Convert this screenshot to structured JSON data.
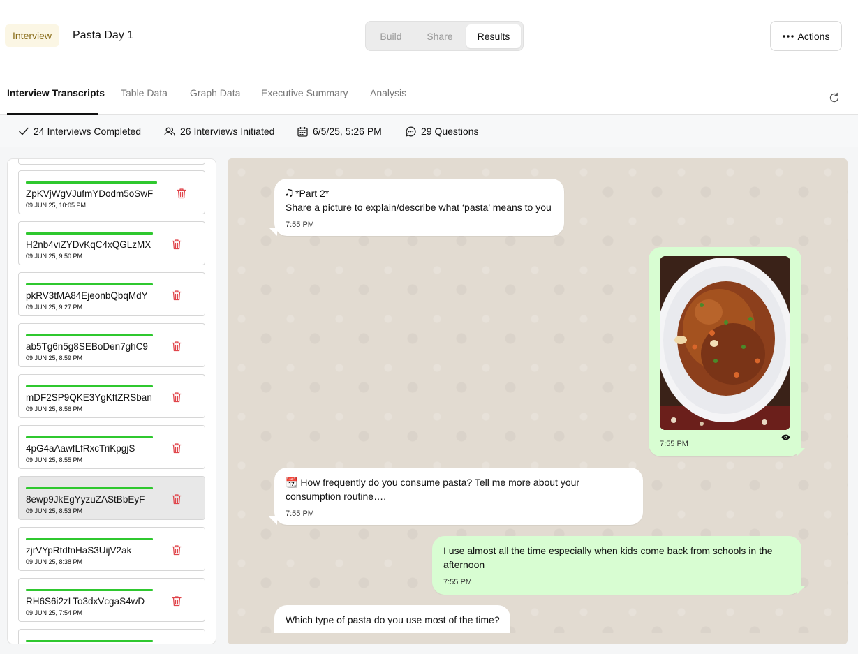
{
  "header": {
    "type_badge": "Interview",
    "title": "Pasta Day 1",
    "segments": [
      "Build",
      "Share",
      "Results"
    ],
    "active_segment": "Results",
    "actions_label": "Actions"
  },
  "tabs": {
    "items": [
      "Interview Transcripts",
      "Table Data",
      "Graph Data",
      "Executive Summary",
      "Analysis"
    ],
    "active": "Interview Transcripts"
  },
  "stats": {
    "completed": "24 Interviews Completed",
    "initiated": "26 Interviews Initiated",
    "date": "6/5/25, 5:26 PM",
    "questions": "29 Questions"
  },
  "interviews": [
    {
      "id": "ZpKVjWgVJufmYDodm5oSwF",
      "date": "09 JUN 25, 10:05 PM"
    },
    {
      "id": "H2nb4viZYDvKqC4xQGLzMX",
      "date": "09 JUN 25, 9:50 PM"
    },
    {
      "id": "pkRV3tMA84EjeonbQbqMdY",
      "date": "09 JUN 25, 9:27 PM"
    },
    {
      "id": "ab5Tg6n5g8SEBoDen7ghC9",
      "date": "09 JUN 25, 8:59 PM"
    },
    {
      "id": "mDF2SP9QKE3YgKftZRSban",
      "date": "09 JUN 25, 8:56 PM"
    },
    {
      "id": "4pG4aAawfLfRxcTriKpgjS",
      "date": "09 JUN 25, 8:55 PM"
    },
    {
      "id": "8ewp9JkEgYyzuZAStBbEyF",
      "date": "09 JUN 25, 8:53 PM"
    },
    {
      "id": "zjrVYpRtdfnHaS3UijV2ak",
      "date": "09 JUN 25, 8:38 PM"
    },
    {
      "id": "RH6S6i2zLTo3dxVcgaS4wD",
      "date": "09 JUN 25, 7:54 PM"
    }
  ],
  "selected_interview": "8ewp9JkEgYyzuZAStBbEyF",
  "chat": {
    "m1": {
      "line1": "🎝 *Part 2*",
      "line2": "Share a picture to explain/describe what ‘pasta’  means to you",
      "time": "7:55 PM"
    },
    "m2": {
      "time": "7:55 PM",
      "image_desc": "photo of a plate of fried noodles"
    },
    "m3": {
      "line1": "📆 How frequently do you consume pasta? Tell me more about your",
      "line2": "consumption routine….",
      "time": "7:55 PM"
    },
    "m4": {
      "line1": "I use almost all the time especially when kids come back from schools in the",
      "line2": "afternoon",
      "time": "7:55 PM"
    },
    "m5": {
      "line1": "Which type of pasta do you use most of the time?"
    }
  },
  "colors": {
    "accent_green": "#2fc82f",
    "trash_red": "#e0454b",
    "bubble_out": "#d8fdd2",
    "badge_bg": "#fbf6e4"
  }
}
